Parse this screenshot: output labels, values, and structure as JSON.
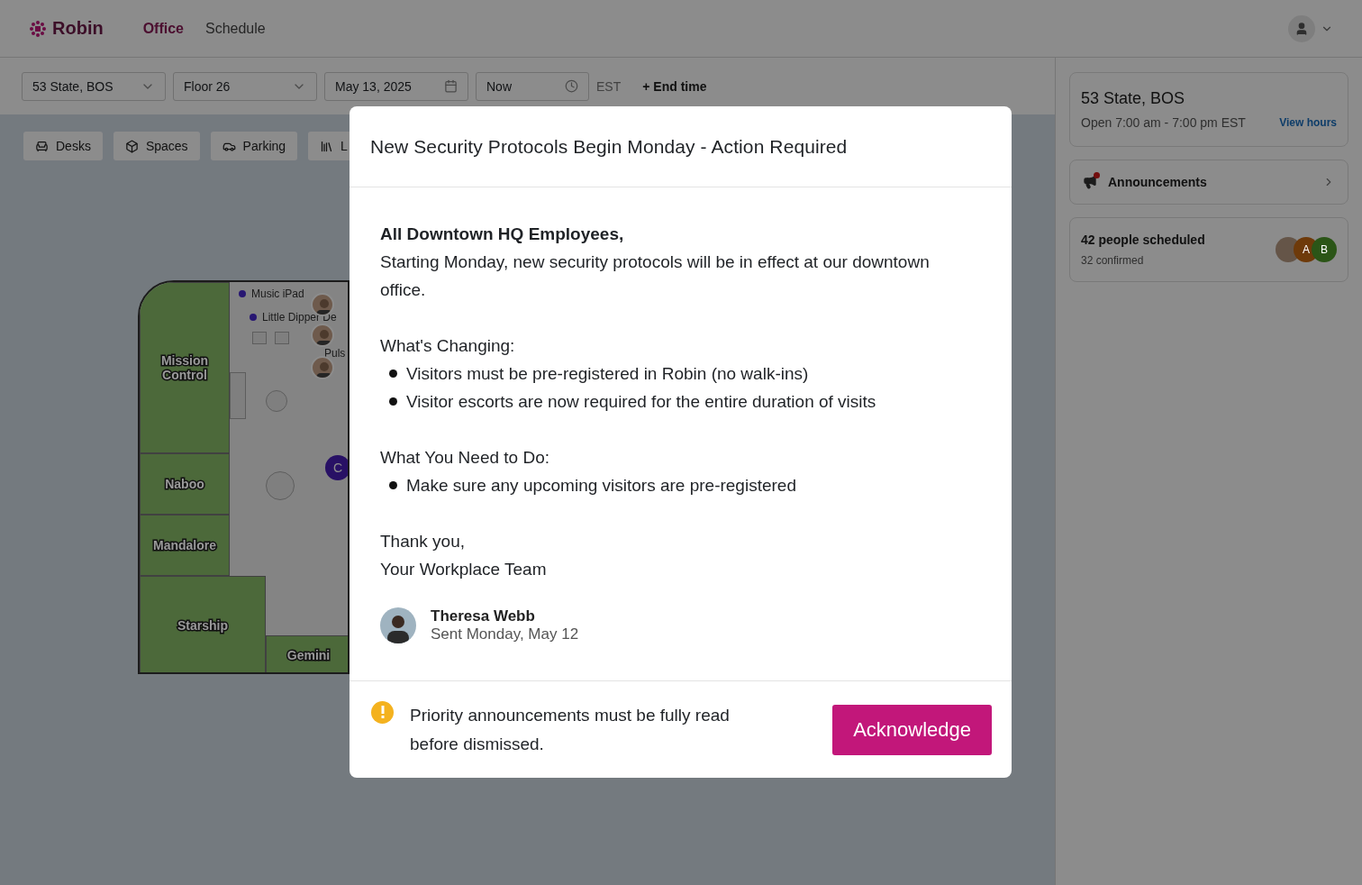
{
  "header": {
    "logo": "Robin",
    "nav": [
      {
        "label": "Office",
        "selected": true
      },
      {
        "label": "Schedule",
        "selected": false
      }
    ]
  },
  "filters": {
    "building": "53 State, BOS",
    "floor": "Floor 26",
    "date": "May 13, 2025",
    "time": "Now",
    "timezone": "EST",
    "end_time": "+ End time"
  },
  "space_tabs": [
    {
      "label": "Desks",
      "kind": "desk"
    },
    {
      "label": "Spaces",
      "kind": "space"
    },
    {
      "label": "Parking",
      "kind": "parking"
    },
    {
      "label": "L",
      "kind": "locker"
    }
  ],
  "map": {
    "rooms": [
      {
        "name": "Mission Control"
      },
      {
        "name": "Naboo"
      },
      {
        "name": "Mandalore"
      },
      {
        "name": "Starship"
      },
      {
        "name": "Gemini"
      }
    ],
    "labels": [
      {
        "text": "Music iPad"
      },
      {
        "text": "Little Dipper De"
      },
      {
        "text": "Puls"
      }
    ],
    "avatar": "C"
  },
  "sidebar": {
    "location": {
      "title": "53 State, BOS",
      "hours": "Open 7:00 am - 7:00 pm EST",
      "link": "View hours"
    },
    "announcements": {
      "label": "Announcements",
      "unread": true
    },
    "schedule": {
      "title": "42 people scheduled",
      "subtitle": "32 confirmed",
      "avatars": [
        {
          "initial": "A",
          "color": "#6e3a0a"
        },
        {
          "initial": "B",
          "color": "#2b5517"
        }
      ]
    }
  },
  "modal": {
    "title": "New Security Protocols Begin Monday - Action Required",
    "blocks": [
      {
        "kind": "greeting",
        "text": "All Downtown HQ Employees,"
      },
      {
        "kind": "text",
        "text": "Starting Monday, new security protocols will be in effect at our downtown office."
      },
      {
        "kind": "text",
        "text": "What's Changing:"
      },
      {
        "kind": "bullets",
        "items": [
          "Visitors must be pre-registered in Robin (no walk-ins)",
          "Visitor escorts are now required for the entire duration of visits"
        ]
      },
      {
        "kind": "text",
        "text": "What You Need to Do:"
      },
      {
        "kind": "bullets",
        "items": [
          "Make sure any upcoming visitors are pre-registered"
        ]
      },
      {
        "kind": "signoff",
        "lines": [
          "Thank you,",
          "Your Workplace Team"
        ]
      }
    ],
    "author": {
      "name": "Theresa Webb",
      "sent": "Sent Monday, May 12"
    },
    "notice": "Priority announcements must be fully read before dismissed.",
    "button": "Acknowledge"
  }
}
